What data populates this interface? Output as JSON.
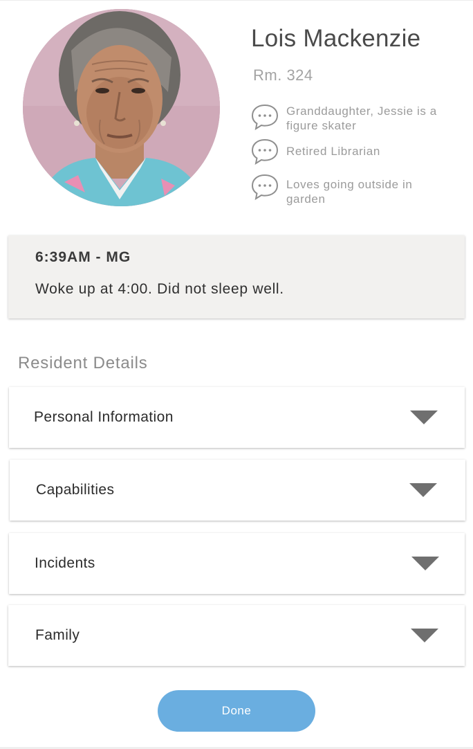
{
  "resident": {
    "name": "Lois Mackenzie",
    "room": "Rm. 324",
    "notes": [
      {
        "icon": "chat-bubble-icon",
        "text": "Granddaughter, Jessie is a figure skater"
      },
      {
        "icon": "chat-bubble-icon",
        "text": "Retired Librarian"
      },
      {
        "icon": "chat-bubble-icon",
        "text": "Loves going outside in garden"
      }
    ]
  },
  "log_entry": {
    "time_author": "6:39AM - MG",
    "text": "Woke up at 4:00. Did not sleep well."
  },
  "details": {
    "title": "Resident Details",
    "sections": [
      {
        "label": "Personal Information",
        "icon": "chevron-down-icon"
      },
      {
        "label": "Capabilities",
        "icon": "chevron-down-icon"
      },
      {
        "label": "Incidents",
        "icon": "chevron-down-icon"
      },
      {
        "label": "Family",
        "icon": "chevron-down-icon"
      }
    ]
  },
  "actions": {
    "done_label": "Done"
  },
  "colors": {
    "accent": "#6aaee0",
    "log_background": "#f2f1ef",
    "muted_text": "#9b9b9b"
  }
}
